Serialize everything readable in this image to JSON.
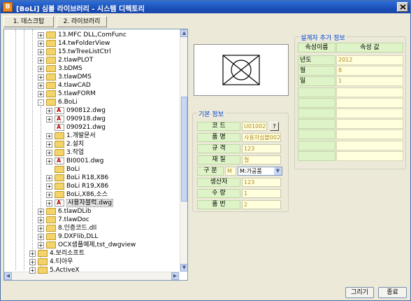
{
  "window": {
    "title": "[BoLi] 심볼 라이브러리 - 시스템 디렉토리",
    "icon_letter": "B"
  },
  "tabs": [
    {
      "label": "1. 데스크탑"
    },
    {
      "label": "2. 라이브러리"
    }
  ],
  "tree": {
    "items": [
      {
        "label": "13.MFC DLL,ComFunc",
        "type": "folder",
        "depth": 2,
        "expander": "+"
      },
      {
        "label": "14.twFolderView",
        "type": "folder",
        "depth": 2,
        "expander": "+"
      },
      {
        "label": "15.twTreeListCtrl",
        "type": "folder",
        "depth": 2,
        "expander": "+"
      },
      {
        "label": "2.tlawPLOT",
        "type": "folder",
        "depth": 2,
        "expander": "+"
      },
      {
        "label": "3.bDMS",
        "type": "folder",
        "depth": 2,
        "expander": "+"
      },
      {
        "label": "3.tlawDMS",
        "type": "folder",
        "depth": 2,
        "expander": "+"
      },
      {
        "label": "4.tlawCAD",
        "type": "folder",
        "depth": 2,
        "expander": "+"
      },
      {
        "label": "5.tlawFORM",
        "type": "folder",
        "depth": 2,
        "expander": "+"
      },
      {
        "label": "6.BoLi",
        "type": "folder",
        "depth": 2,
        "expander": "-"
      },
      {
        "label": "090812.dwg",
        "type": "dwg",
        "depth": 3,
        "expander": "+"
      },
      {
        "label": "090918.dwg",
        "type": "dwg",
        "depth": 3,
        "expander": "+"
      },
      {
        "label": "090921.dwg",
        "type": "dwg",
        "depth": 3,
        "expander": ""
      },
      {
        "label": "1.개발문서",
        "type": "folder",
        "depth": 3,
        "expander": "+"
      },
      {
        "label": "2.설치",
        "type": "folder",
        "depth": 3,
        "expander": "+"
      },
      {
        "label": "3.작업",
        "type": "folder",
        "depth": 3,
        "expander": "+"
      },
      {
        "label": "BI0001.dwg",
        "type": "dwg",
        "depth": 3,
        "expander": "+"
      },
      {
        "label": "BoLi",
        "type": "folder",
        "depth": 3,
        "expander": ""
      },
      {
        "label": "BoLi R18,X86",
        "type": "folder",
        "depth": 3,
        "expander": "+"
      },
      {
        "label": "BoLi R19,X86",
        "type": "folder",
        "depth": 3,
        "expander": "+"
      },
      {
        "label": "BoLi,X86,소스",
        "type": "folder",
        "depth": 3,
        "expander": "+"
      },
      {
        "label": "사용자블럭.dwg",
        "type": "dwg",
        "depth": 3,
        "expander": "+",
        "selected": true
      },
      {
        "label": "6.tlawDLib",
        "type": "folder",
        "depth": 2,
        "expander": "+"
      },
      {
        "label": "7.tlawDoc",
        "type": "folder",
        "depth": 2,
        "expander": "+"
      },
      {
        "label": "8.인증코드.dll",
        "type": "folder",
        "depth": 2,
        "expander": "+"
      },
      {
        "label": "9.DXFlib,DLL",
        "type": "folder",
        "depth": 2,
        "expander": "+"
      },
      {
        "label": "OCX샘플예제,tst_dwgview",
        "type": "folder",
        "depth": 2,
        "expander": "+"
      },
      {
        "label": "4.보리소프트",
        "type": "folder",
        "depth": 1,
        "expander": "+"
      },
      {
        "label": "4.티아우",
        "type": "folder",
        "depth": 1,
        "expander": "+"
      },
      {
        "label": "5.ActiveX",
        "type": "folder",
        "depth": 1,
        "expander": "+"
      }
    ]
  },
  "basic_info": {
    "title": "기본 정보",
    "code_label": "코   드",
    "code_value": "U01002",
    "code_button": "?",
    "name_label": "품   명",
    "name_value": "사용자심볼002",
    "spec_label": "규   격",
    "spec_value": "123",
    "material_label": "재   질",
    "material_value": "철",
    "class_label": "구   분",
    "class_code": "M",
    "class_value": "M:가공품",
    "maker_label": "생산자",
    "maker_value": "123",
    "qty_label": "수   량",
    "qty_value": "1",
    "part_no_label": "품   번",
    "part_no_value": "2"
  },
  "designer_info": {
    "title": "설계자 추가 정보",
    "col_name": "속성이름",
    "col_value": "속성 값",
    "rows": [
      {
        "name": "년도",
        "value": "2012"
      },
      {
        "name": "월",
        "value": "8"
      },
      {
        "name": "일",
        "value": "1"
      },
      {
        "name": "",
        "value": ""
      },
      {
        "name": "",
        "value": ""
      },
      {
        "name": "",
        "value": ""
      },
      {
        "name": "",
        "value": ""
      },
      {
        "name": "",
        "value": ""
      },
      {
        "name": "",
        "value": ""
      },
      {
        "name": "",
        "value": ""
      }
    ]
  },
  "buttons": {
    "draw": "그리기",
    "exit": "종료"
  },
  "colors": {
    "titlebar": "#1c4fb8",
    "group_title": "#0046d5",
    "label_bg": "#dff3c8",
    "value_bg": "#ffffdd"
  }
}
